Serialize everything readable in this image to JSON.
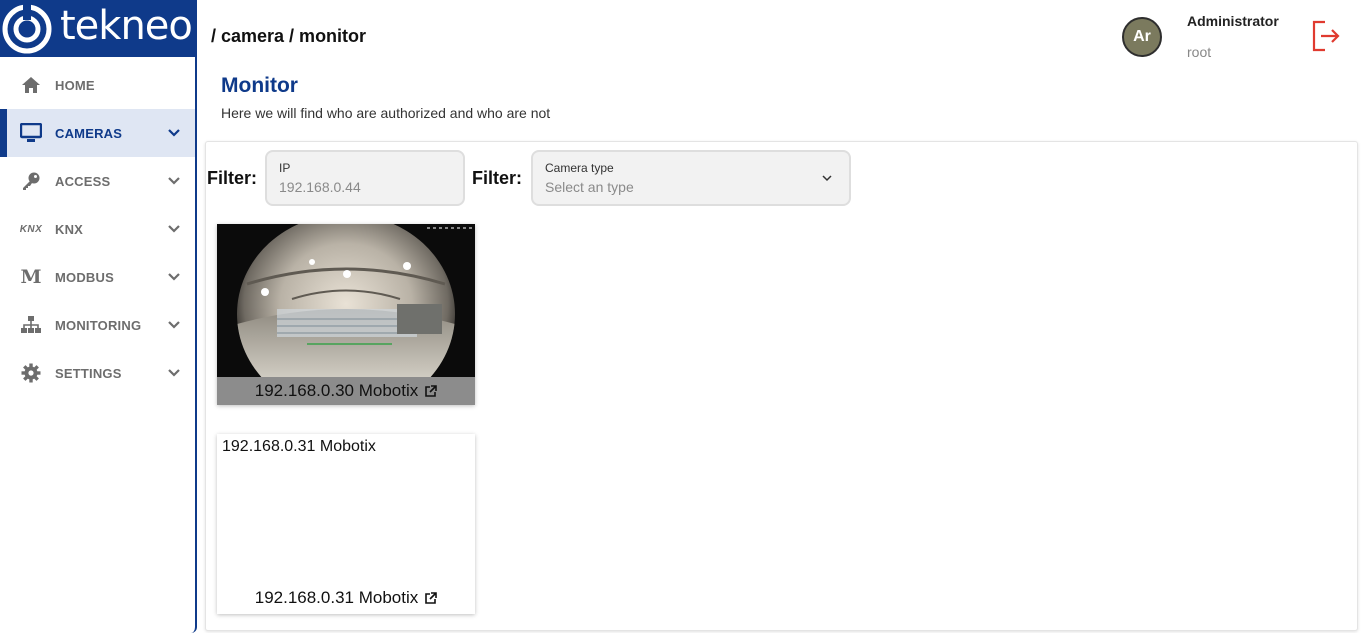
{
  "app": {
    "logo_text": "tekneo"
  },
  "sidebar": {
    "items": [
      {
        "label": "HOME",
        "icon": "home-icon"
      },
      {
        "label": "CAMERAS",
        "icon": "monitor-icon",
        "active": true
      },
      {
        "label": "ACCESS",
        "icon": "key-icon"
      },
      {
        "label": "KNX",
        "icon": "knx-icon",
        "icon_text": "KNX"
      },
      {
        "label": "MODBUS",
        "icon": "modbus-icon",
        "icon_text": "M"
      },
      {
        "label": "MONITORING",
        "icon": "sitemap-icon"
      },
      {
        "label": "SETTINGS",
        "icon": "gear-icon"
      }
    ]
  },
  "header": {
    "breadcrumb": "/ camera / monitor",
    "user": {
      "initials": "Ar",
      "name": "Administrator",
      "role": "root"
    }
  },
  "main": {
    "title": "Monitor",
    "subtitle": "Here we will find who are authorized and who are not",
    "filters": [
      {
        "label": "Filter:",
        "field_label": "IP",
        "value": "192.168.0.44"
      },
      {
        "label": "Filter:",
        "field_label": "Camera type",
        "placeholder": "Select an type"
      }
    ],
    "cameras": [
      {
        "caption": "192.168.0.30 Mobotix",
        "has_image": true
      },
      {
        "alt_text": "192.168.0.31 Mobotix",
        "caption": "192.168.0.31 Mobotix",
        "has_image": false
      }
    ]
  },
  "colors": {
    "brand": "#0f3a8a",
    "active_bg": "#dfe6f3",
    "logout": "#e03a2f"
  }
}
